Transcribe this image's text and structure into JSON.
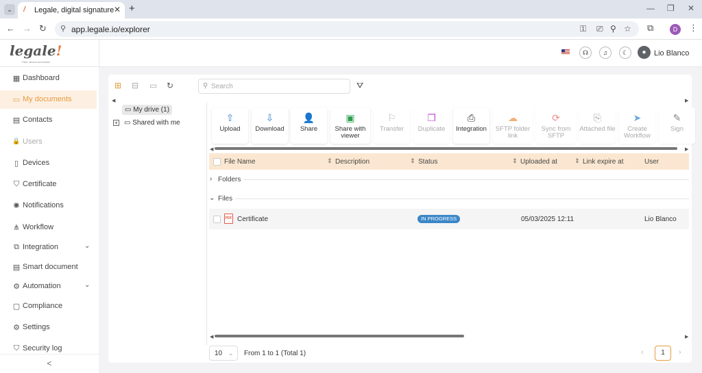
{
  "browser": {
    "tab_title": "Legale, digital signature",
    "url": "app.legale.io/explorer",
    "profile_initial": "D"
  },
  "app": {
    "logo_text": "legale",
    "logo_tagline": "Fast, secure and smart",
    "username": "Lio Blanco"
  },
  "sidebar": {
    "items": [
      {
        "label": "Dashboard",
        "icon": "dashboard-icon",
        "glyph": "▦"
      },
      {
        "label": "My documents",
        "icon": "folder-icon",
        "glyph": "▭"
      },
      {
        "label": "Contacts",
        "icon": "contacts-icon",
        "glyph": "▤"
      },
      {
        "label": "Users",
        "icon": "lock-icon",
        "glyph": "🔒"
      },
      {
        "label": "Devices",
        "icon": "device-icon",
        "glyph": "▯"
      },
      {
        "label": "Certificate",
        "icon": "shield-icon",
        "glyph": "⛉"
      },
      {
        "label": "Notifications",
        "icon": "bell-icon",
        "glyph": "✺"
      },
      {
        "label": "Workflow",
        "icon": "workflow-icon",
        "glyph": "⋔"
      },
      {
        "label": "Integration",
        "icon": "integration-icon",
        "glyph": "⧉"
      },
      {
        "label": "Smart document",
        "icon": "smart-document-icon",
        "glyph": "▤"
      },
      {
        "label": "Automation",
        "icon": "automation-icon",
        "glyph": "⚙"
      },
      {
        "label": "Compliance",
        "icon": "compliance-icon",
        "glyph": "▢"
      },
      {
        "label": "Settings",
        "icon": "settings-icon",
        "glyph": "⚙"
      },
      {
        "label": "Security log",
        "icon": "security-log-icon",
        "glyph": "⛉"
      }
    ],
    "collapse_glyph": "<"
  },
  "search": {
    "placeholder": "Search"
  },
  "tree": {
    "my_drive": "My drive (1)",
    "shared": "Shared with me"
  },
  "actions": [
    {
      "label": "Upload",
      "icon": "upload-icon",
      "glyph": "⇧",
      "color": "#3a86c8",
      "enabled": true
    },
    {
      "label": "Download",
      "icon": "download-icon",
      "glyph": "⇩",
      "color": "#3a86c8",
      "enabled": true
    },
    {
      "label": "Share",
      "icon": "add-user-icon",
      "glyph": "👤",
      "color": "#3a86c8",
      "enabled": true
    },
    {
      "label": "Share with viewer",
      "icon": "share-viewer-icon",
      "glyph": "▣",
      "color": "#2e9e4f",
      "enabled": true
    },
    {
      "label": "Transfer",
      "icon": "transfer-icon",
      "glyph": "⚐",
      "color": "#bbbbbb",
      "enabled": false
    },
    {
      "label": "Duplicate",
      "icon": "duplicate-icon",
      "glyph": "❐",
      "color": "#c04fd6",
      "enabled": false
    },
    {
      "label": "Integration",
      "icon": "printer-icon",
      "glyph": "⎙",
      "color": "#333333",
      "enabled": true
    },
    {
      "label": "SFTP folder link",
      "icon": "cloud-icon",
      "glyph": "☁",
      "color": "#f0b078",
      "enabled": false
    },
    {
      "label": "Sync from SFTP",
      "icon": "sync-icon",
      "glyph": "⟳",
      "color": "#f08a8a",
      "enabled": false
    },
    {
      "label": "Attached file",
      "icon": "paperclip-icon",
      "glyph": "⎘",
      "color": "#aaaaaa",
      "enabled": false
    },
    {
      "label": "Create Workflow",
      "icon": "send-icon",
      "glyph": "➤",
      "color": "#6fa8dc",
      "enabled": false
    },
    {
      "label": "Sign",
      "icon": "sign-icon",
      "glyph": "✎",
      "color": "#888888",
      "enabled": false
    }
  ],
  "table": {
    "columns": [
      "File Name",
      "Description",
      "Status",
      "Uploaded at",
      "Link expire at",
      "User"
    ],
    "groups": {
      "folders": "Folders",
      "files": "Files"
    },
    "rows": [
      {
        "file_name": "Certificate",
        "file_type": "PDF",
        "status": "IN PROGRESS",
        "uploaded_at": "05/03/2025 12:11",
        "user": "Lio Blanco"
      }
    ]
  },
  "pagination": {
    "page_size": "10",
    "info": "From 1 to 1 (Total 1)",
    "current_page": "1"
  },
  "colors": {
    "accent": "#e59b3d",
    "status_badge": "#3a86c8",
    "header_row": "#fbe7d1"
  }
}
